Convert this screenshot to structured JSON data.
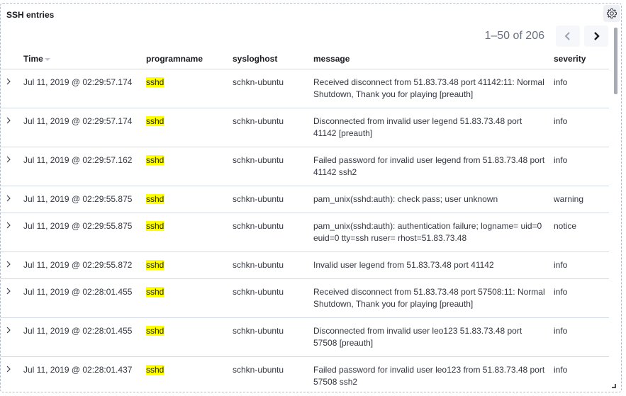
{
  "panel": {
    "title": "SSH entries",
    "settings_icon": "gear-icon"
  },
  "pagination": {
    "range_text": "1–50 of 206",
    "prev_icon": "chevron-left-icon",
    "next_icon": "chevron-right-icon"
  },
  "table": {
    "columns": [
      "Time",
      "programname",
      "sysloghost",
      "message",
      "severity"
    ],
    "sort_column": "Time",
    "rows": [
      {
        "time": "Jul 11, 2019 @ 02:29:57.174",
        "programname": "sshd",
        "sysloghost": "schkn-ubuntu",
        "message": "Received disconnect from 51.83.73.48 port 41142:11: Normal Shutdown, Thank you for playing [preauth]",
        "severity": "info"
      },
      {
        "time": "Jul 11, 2019 @ 02:29:57.174",
        "programname": "sshd",
        "sysloghost": "schkn-ubuntu",
        "message": "Disconnected from invalid user legend 51.83.73.48 port 41142 [preauth]",
        "severity": "info"
      },
      {
        "time": "Jul 11, 2019 @ 02:29:57.162",
        "programname": "sshd",
        "sysloghost": "schkn-ubuntu",
        "message": "Failed password for invalid user legend from 51.83.73.48 port 41142 ssh2",
        "severity": "info"
      },
      {
        "time": "Jul 11, 2019 @ 02:29:55.875",
        "programname": "sshd",
        "sysloghost": "schkn-ubuntu",
        "message": "pam_unix(sshd:auth): check pass; user unknown",
        "severity": "warning"
      },
      {
        "time": "Jul 11, 2019 @ 02:29:55.875",
        "programname": "sshd",
        "sysloghost": "schkn-ubuntu",
        "message": "pam_unix(sshd:auth): authentication failure; logname= uid=0 euid=0 tty=ssh ruser= rhost=51.83.73.48",
        "severity": "notice"
      },
      {
        "time": "Jul 11, 2019 @ 02:29:55.872",
        "programname": "sshd",
        "sysloghost": "schkn-ubuntu",
        "message": "Invalid user legend from 51.83.73.48 port 41142",
        "severity": "info"
      },
      {
        "time": "Jul 11, 2019 @ 02:28:01.455",
        "programname": "sshd",
        "sysloghost": "schkn-ubuntu",
        "message": "Received disconnect from 51.83.73.48 port 57508:11: Normal Shutdown, Thank you for playing [preauth]",
        "severity": "info"
      },
      {
        "time": "Jul 11, 2019 @ 02:28:01.455",
        "programname": "sshd",
        "sysloghost": "schkn-ubuntu",
        "message": "Disconnected from invalid user leo123 51.83.73.48 port 57508 [preauth]",
        "severity": "info"
      },
      {
        "time": "Jul 11, 2019 @ 02:28:01.437",
        "programname": "sshd",
        "sysloghost": "schkn-ubuntu",
        "message": "Failed password for invalid user leo123 from 51.83.73.48 port 57508 ssh2",
        "severity": "info"
      }
    ]
  },
  "colors": {
    "highlight": "#ffff00",
    "border": "#d3dae6"
  }
}
